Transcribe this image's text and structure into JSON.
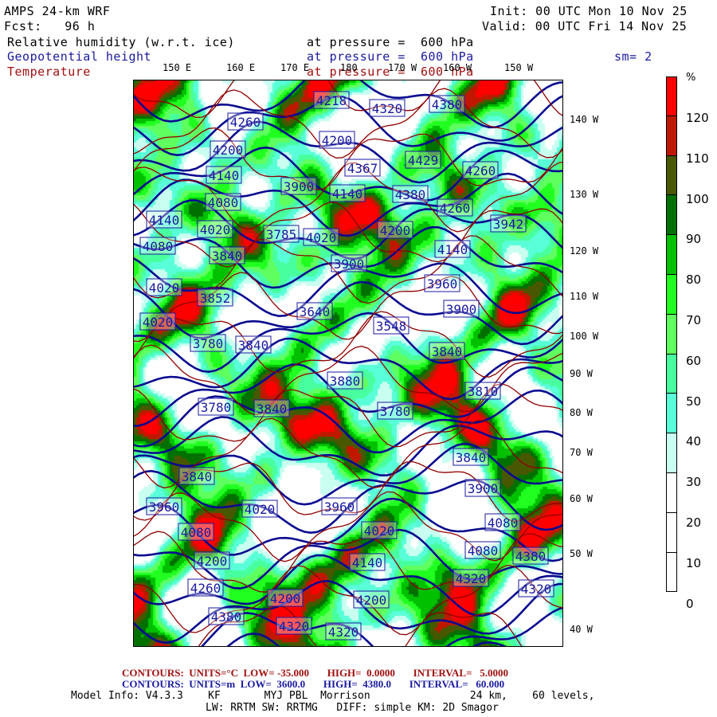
{
  "header": {
    "model": "AMPS 24-km WRF",
    "fcst": "Fcst:   96 h",
    "init": "Init: 00 UTC Mon 10 Nov 25",
    "valid": "Valid: 00 UTC Fri 14 Nov 25",
    "fields": [
      {
        "name": "Relative humidity (w.r.t. ice)",
        "level": "at pressure =  600 hPa",
        "color": "#000000"
      },
      {
        "name": "Geopotential height",
        "level": "at pressure =  600 hPa",
        "color": "#1a1aa0"
      },
      {
        "name": "Temperature",
        "level": "at pressure =  600 hPa",
        "color": "#a01010"
      }
    ],
    "smoothing": "sm= 2"
  },
  "longitude_labels": [
    "150 E",
    "160 E",
    "170 E",
    "180",
    "170 W",
    "160 W",
    "150 W"
  ],
  "latitude_labels": [
    "140 W",
    "130 W",
    "120 W",
    "110 W",
    "100 W",
    "90 W",
    "80 W",
    "70 W",
    "60 W",
    "50 W",
    "40 W"
  ],
  "colorbar": {
    "unit": "%",
    "ticks": [
      "120",
      "110",
      "100",
      "90",
      "80",
      "70",
      "60",
      "50",
      "40",
      "30",
      "20",
      "10",
      "0"
    ],
    "colors": [
      "#ff0000",
      "#c01800",
      "#485800",
      "#007000",
      "#00c000",
      "#20ff20",
      "#60ff60",
      "#48ffa0",
      "#58ffd8",
      "#c8fff0",
      "#ffffff",
      "#ffffff",
      "#ffffff",
      "#ffffff"
    ]
  },
  "contour_labels": [
    "4218",
    "4320",
    "4380",
    "4260",
    "4200",
    "4140",
    "4080",
    "4140",
    "4020",
    "4080",
    "3840",
    "3785",
    "3900",
    "4140",
    "4380",
    "4200",
    "4140",
    "3900",
    "4260",
    "4429",
    "4260",
    "3942",
    "4367",
    "4200",
    "4020",
    "3960",
    "3900",
    "3640",
    "3548",
    "4020",
    "3852",
    "4020",
    "3780",
    "3840",
    "3840",
    "3880",
    "3780",
    "3780",
    "3840",
    "3810",
    "3840",
    "3900",
    "3840",
    "3960",
    "4020",
    "3960",
    "4080",
    "4020",
    "4080",
    "4200",
    "4140",
    "4080",
    "4380",
    "4260",
    "4200",
    "4200",
    "4320",
    "4320",
    "4380",
    "4320",
    "4320"
  ],
  "footer": {
    "temp_contours": "CONTOURS:  UNITS=°C  LOW= -35.000       HIGH=  0.0000       INTERVAL=   5.0000",
    "height_contours": "CONTOURS:  UNITS=m  LOW=  3600.0       HIGH=  4380.0       INTERVAL=   60.000",
    "model_info": "Model Info: V4.3.3    KF       MYJ PBL  Morrison                24 km,    60 levels,",
    "physics": "LW: RRTM SW: RRTMG   DIFF: simple KM: 2D Smagor"
  }
}
